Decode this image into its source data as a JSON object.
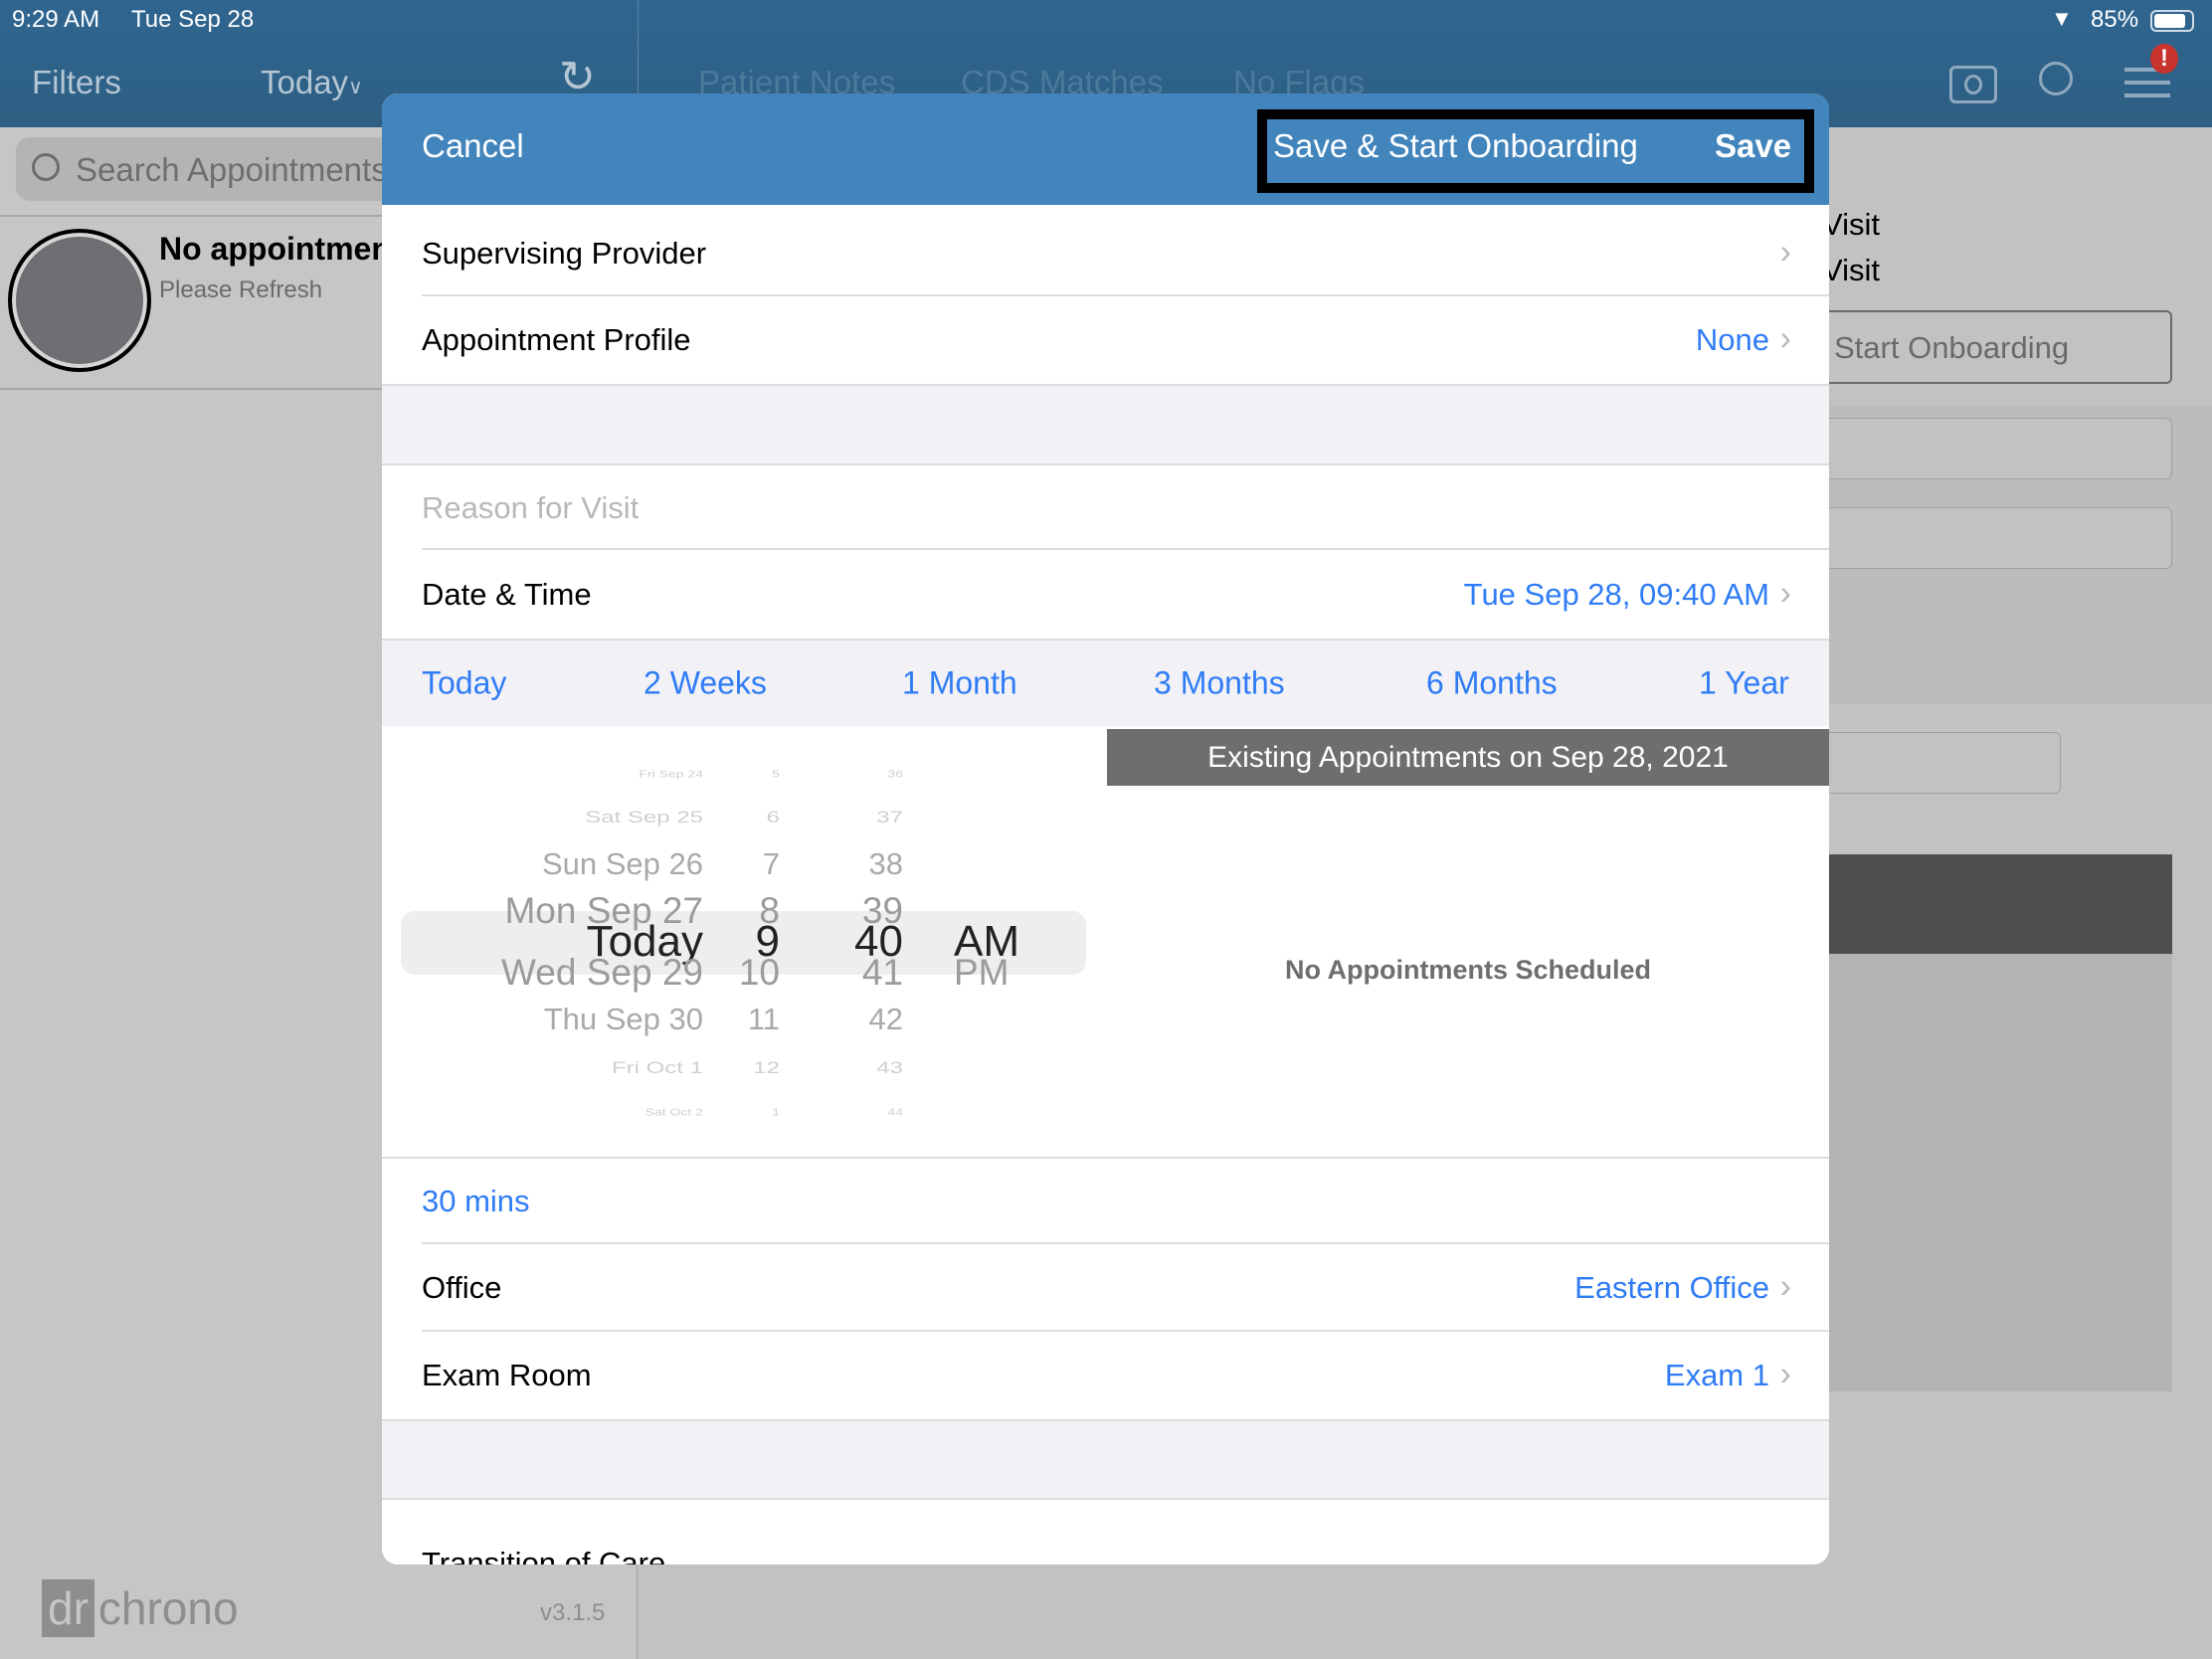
{
  "status": {
    "time": "9:29 AM",
    "date": "Tue Sep 28",
    "battery": "85%"
  },
  "nav": {
    "filters": "Filters",
    "today": "Today",
    "tabs": [
      "Patient Notes",
      "CDS Matches",
      "No Flags"
    ]
  },
  "left": {
    "search_placeholder": "Search Appointments",
    "empty_title": "No appointments",
    "empty_sub": "Please Refresh",
    "logo": "drchrono",
    "version": "v3.1.5"
  },
  "background": {
    "visit1": "Visit",
    "visit2": "Visit",
    "start_onboarding": "Start Onboarding"
  },
  "modal": {
    "cancel": "Cancel",
    "save_start": "Save & Start Onboarding",
    "save": "Save",
    "supervising_provider": "Supervising Provider",
    "appointment_profile": {
      "label": "Appointment Profile",
      "value": "None"
    },
    "reason_placeholder": "Reason for Visit",
    "date_time": {
      "label": "Date & Time",
      "value": "Tue Sep 28, 09:40 AM"
    },
    "quick_options": [
      "Today",
      "2 Weeks",
      "1 Month",
      "3 Months",
      "6 Months",
      "1 Year"
    ],
    "picker": {
      "days": [
        "Fri Sep 24",
        "Sat Sep 25",
        "Sun Sep 26",
        "Mon Sep 27",
        "Today",
        "Wed Sep 29",
        "Thu Sep 30",
        "Fri Oct 1",
        "Sat Oct 2"
      ],
      "hours": [
        "5",
        "6",
        "7",
        "8",
        "9",
        "10",
        "11",
        "12",
        "1"
      ],
      "minutes": [
        "36",
        "37",
        "38",
        "39",
        "40",
        "41",
        "42",
        "43",
        "44"
      ],
      "ampm": [
        "AM",
        "PM"
      ]
    },
    "existing_header": "Existing Appointments on Sep 28, 2021",
    "no_appointments": "No Appointments Scheduled",
    "duration": "30 mins",
    "office": {
      "label": "Office",
      "value": "Eastern Office"
    },
    "exam_room": {
      "label": "Exam Room",
      "value": "Exam 1"
    },
    "transition": "Transition of Care"
  },
  "colors": {
    "accent": "#2f7cf6",
    "header": "#4285bc",
    "alert": "#c8332e"
  }
}
